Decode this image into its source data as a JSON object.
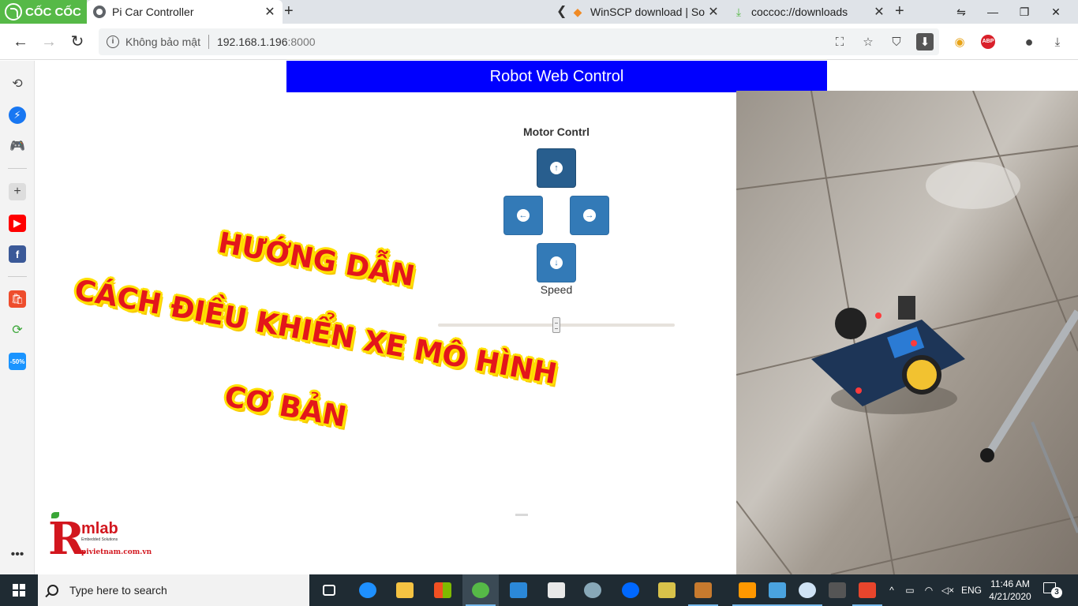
{
  "browser": {
    "brand": "CỐC CỐC",
    "tabs": [
      {
        "title": "Pi Car Controller",
        "active": true
      },
      {
        "title": "WinSCP download | So",
        "active": false
      },
      {
        "title": "coccoc://downloads",
        "active": false
      }
    ],
    "address": {
      "security_label": "Không bảo mật",
      "host": "192.168.1.196",
      "port": ":8000"
    }
  },
  "page": {
    "header_title": "Robot Web Control",
    "motor_title": "Motor Contrl",
    "speed_label": "Speed",
    "speed_value": 0.5,
    "pressed_button": "forward",
    "colors": {
      "header": "#0000ff",
      "button": "#337ab7",
      "button_pressed": "#285e8e"
    }
  },
  "overlay": {
    "line1": "HƯỚNG DẪN",
    "line2": "CÁCH ĐIỀU KHIỂN XE MÔ HÌNH",
    "line3": "CƠ BẢN"
  },
  "logo": {
    "letter": "R",
    "name": "mlab",
    "tagline": "Embedded Solutions",
    "site": "pivietnam.com.vn"
  },
  "taskbar": {
    "search_placeholder": "Type here to search",
    "language": "ENG",
    "time": "11:46 AM",
    "date": "4/21/2020",
    "notifications": "3"
  }
}
